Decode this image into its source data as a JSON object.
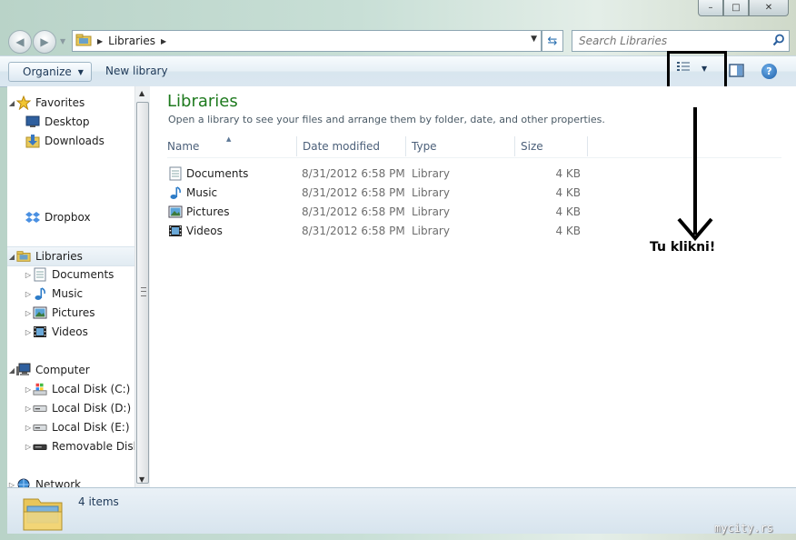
{
  "window": {
    "minimize_glyph": "–",
    "maximize_glyph": "□",
    "close_glyph": "✕"
  },
  "nav": {
    "breadcrumb": [
      "Libraries"
    ],
    "search_placeholder": "Search Libraries"
  },
  "toolbar": {
    "organize_label": "Organize",
    "new_library_label": "New library",
    "help_glyph": "?"
  },
  "sidebar": {
    "favorites": {
      "label": "Favorites",
      "items": [
        {
          "label": "Desktop",
          "icon": "desktop-icon"
        },
        {
          "label": "Downloads",
          "icon": "downloads-icon"
        },
        {
          "label": "Dropbox",
          "icon": "dropbox-icon"
        }
      ]
    },
    "libraries": {
      "label": "Libraries",
      "items": [
        {
          "label": "Documents",
          "icon": "documents-icon"
        },
        {
          "label": "Music",
          "icon": "music-icon"
        },
        {
          "label": "Pictures",
          "icon": "pictures-icon"
        },
        {
          "label": "Videos",
          "icon": "videos-icon"
        }
      ]
    },
    "computer": {
      "label": "Computer",
      "items": [
        {
          "label": "Local Disk (C:)",
          "icon": "windows-drive-icon"
        },
        {
          "label": "Local Disk (D:)",
          "icon": "drive-icon"
        },
        {
          "label": "Local Disk (E:)",
          "icon": "drive-icon"
        },
        {
          "label": "Removable Disk (",
          "icon": "removable-drive-icon"
        }
      ]
    },
    "network": {
      "label": "Network"
    }
  },
  "main": {
    "title": "Libraries",
    "subtitle": "Open a library to see your files and arrange them by folder, date, and other properties.",
    "columns": [
      "Name",
      "Date modified",
      "Type",
      "Size"
    ],
    "rows": [
      {
        "name": "Documents",
        "date": "8/31/2012 6:58 PM",
        "type": "Library",
        "size": "4 KB",
        "icon": "documents-icon"
      },
      {
        "name": "Music",
        "date": "8/31/2012 6:58 PM",
        "type": "Library",
        "size": "4 KB",
        "icon": "music-icon"
      },
      {
        "name": "Pictures",
        "date": "8/31/2012 6:58 PM",
        "type": "Library",
        "size": "4 KB",
        "icon": "pictures-icon"
      },
      {
        "name": "Videos",
        "date": "8/31/2012 6:58 PM",
        "type": "Library",
        "size": "4 KB",
        "icon": "videos-icon"
      }
    ]
  },
  "annotation": {
    "text": "Tu klikni!"
  },
  "status": {
    "item_count": "4 items"
  },
  "watermark": "mycity.rs"
}
